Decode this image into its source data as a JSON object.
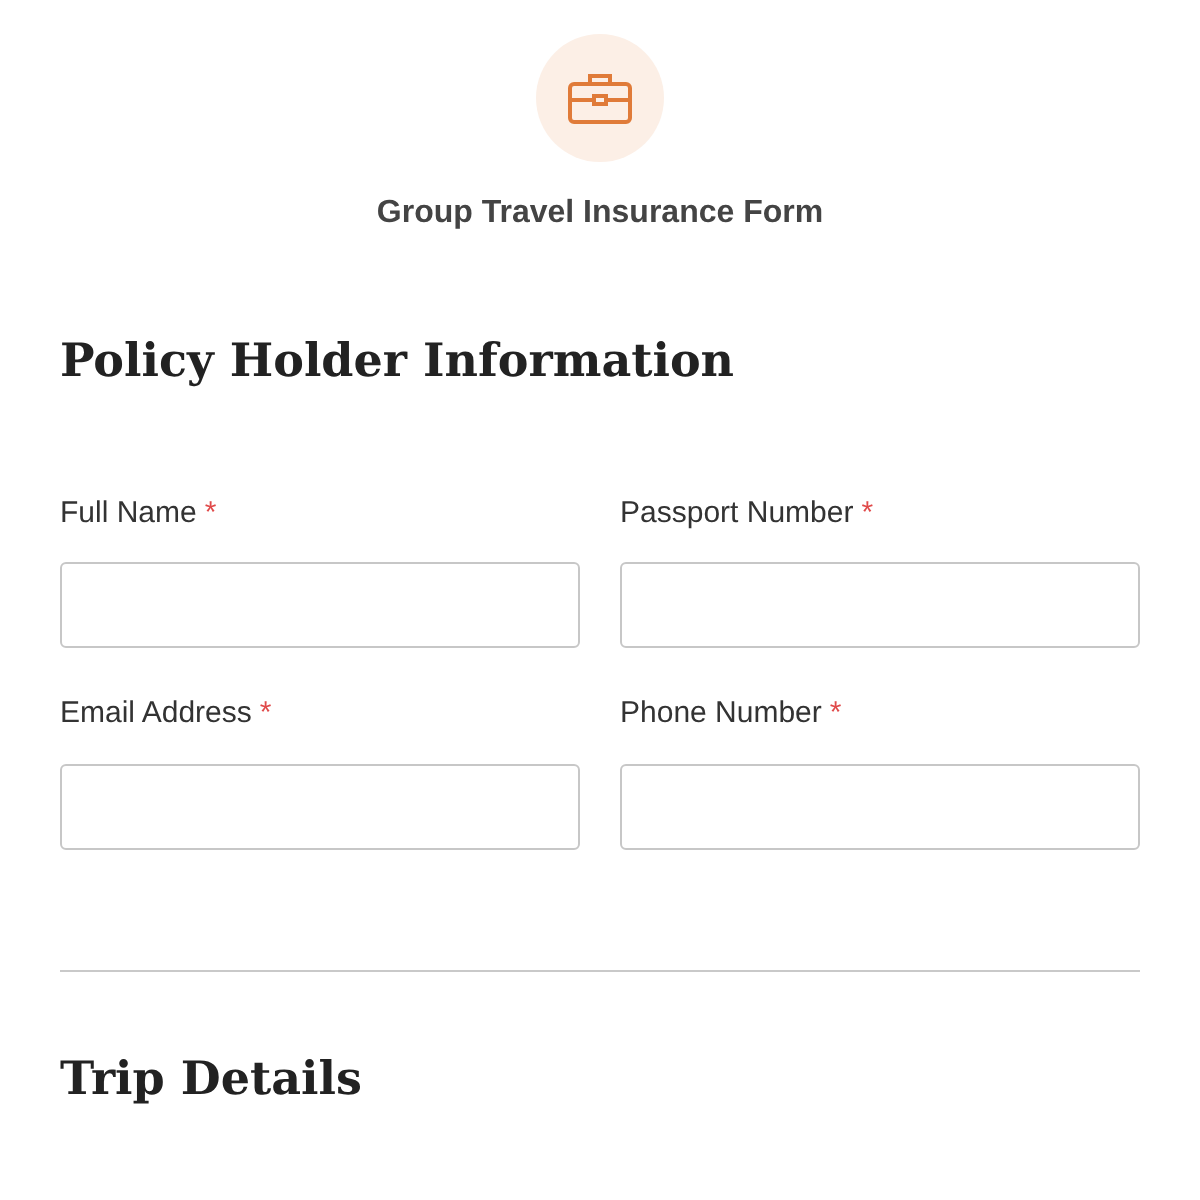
{
  "form": {
    "title": "Group Travel Insurance Form"
  },
  "sections": [
    {
      "heading": "Policy Holder Information",
      "fields": [
        {
          "label": "Full Name",
          "required_mark": "*"
        },
        {
          "label": "Passport Number",
          "required_mark": "*"
        },
        {
          "label": "Email Address",
          "required_mark": "*"
        },
        {
          "label": "Phone Number",
          "required_mark": "*"
        }
      ]
    },
    {
      "heading": "Trip Details"
    }
  ]
}
